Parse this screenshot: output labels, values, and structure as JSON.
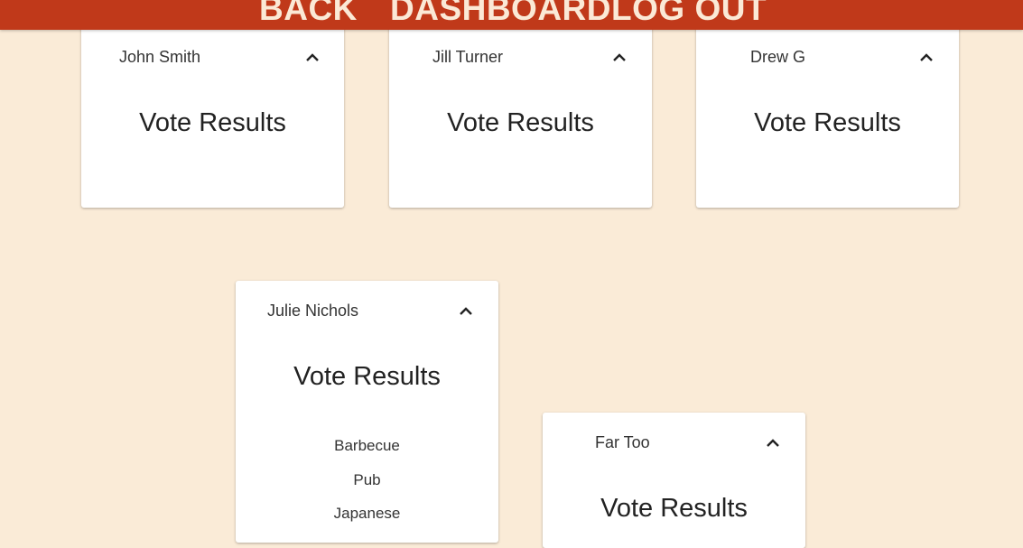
{
  "nav": {
    "back": "BACK",
    "dashboard": "DASHBOARD",
    "logout": "LOG OUT"
  },
  "cards": [
    {
      "name": "John Smith",
      "title": "Vote Results",
      "results": []
    },
    {
      "name": "Jill Turner",
      "title": "Vote Results",
      "results": []
    },
    {
      "name": "Drew G",
      "title": "Vote Results",
      "results": []
    },
    {
      "name": "Julie Nichols",
      "title": "Vote Results",
      "results": [
        "Barbecue",
        "Pub",
        "Japanese"
      ]
    },
    {
      "name": "Far Too",
      "title": "Vote Results",
      "results": []
    }
  ],
  "icons": {
    "collapse": "chevron-up-icon"
  },
  "colors": {
    "topbar": "#c0391a",
    "background": "#faebd7",
    "nav_text": "#fbe9d6"
  }
}
